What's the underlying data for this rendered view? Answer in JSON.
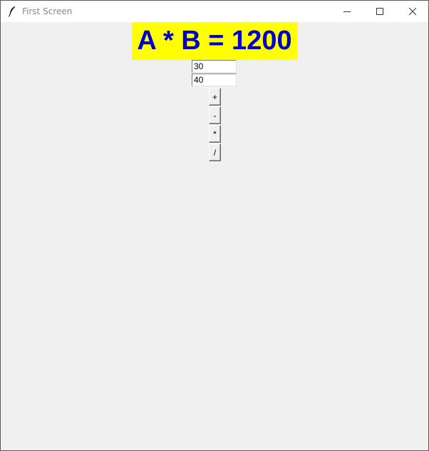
{
  "window": {
    "title": "First Screen"
  },
  "titlebar_icons": {
    "app": "feather-icon",
    "minimize": "minimize-icon",
    "maximize": "maximize-icon",
    "close": "close-icon"
  },
  "result": {
    "text": "A * B = 1200",
    "background": "#ffff00",
    "color": "#0000cc"
  },
  "inputs": {
    "a_value": "30",
    "b_value": "40"
  },
  "buttons": {
    "add": "+",
    "subtract": "-",
    "multiply": "*",
    "divide": "/"
  }
}
